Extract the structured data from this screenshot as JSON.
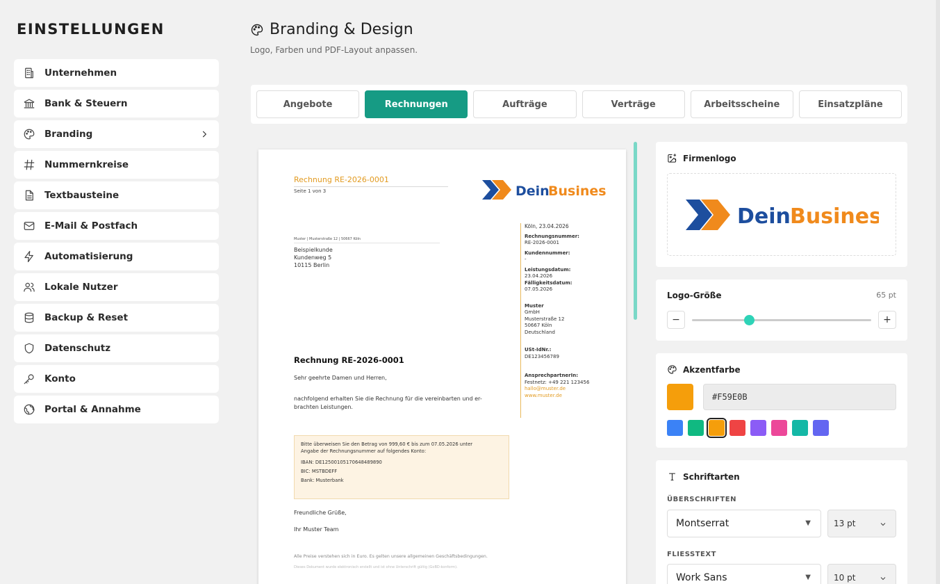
{
  "sidebar": {
    "title": "EINSTELLUNGEN",
    "items": [
      {
        "label": "Unternehmen",
        "icon": "building-icon"
      },
      {
        "label": "Bank & Steuern",
        "icon": "bank-icon"
      },
      {
        "label": "Branding",
        "icon": "palette-icon"
      },
      {
        "label": "Nummernkreise",
        "icon": "hash-icon"
      },
      {
        "label": "Textbausteine",
        "icon": "document-icon"
      },
      {
        "label": "E-Mail & Postfach",
        "icon": "mail-icon"
      },
      {
        "label": "Automatisierung",
        "icon": "lightning-icon"
      },
      {
        "label": "Lokale Nutzer",
        "icon": "users-icon"
      },
      {
        "label": "Backup & Reset",
        "icon": "database-icon"
      },
      {
        "label": "Datenschutz",
        "icon": "shield-icon"
      },
      {
        "label": "Konto",
        "icon": "key-icon"
      },
      {
        "label": "Portal & Annahme",
        "icon": "globe-icon"
      }
    ]
  },
  "header": {
    "title": "Branding & Design",
    "subtitle": "Logo, Farben und PDF-Layout anpassen."
  },
  "tabs": [
    {
      "label": "Angebote"
    },
    {
      "label": "Rechnungen",
      "active": true
    },
    {
      "label": "Aufträge"
    },
    {
      "label": "Verträge"
    },
    {
      "label": "Arbeitsscheine"
    },
    {
      "label": "Einsatzpläne"
    }
  ],
  "preview": {
    "doc_title": "Rechnung RE-2026-0001",
    "page_info": "Seite 1 von 3",
    "logo_text_1": "Dein",
    "logo_text_2": "Business",
    "sender_line": "Muster | Musterstraße 12 | 50667 Köln",
    "recipient": {
      "line1": "Beispielkunde",
      "line2": "Kundenweg 5",
      "line3": "10115 Berlin"
    },
    "meta": {
      "place_date": "Köln, 23.04.2026",
      "invoice_no_label": "Rechnungsnummer:",
      "invoice_no": "RE-2026-0001",
      "customer_no_label": "Kundennummer:",
      "customer_no": "-",
      "service_date_label": "Leistungsdatum:",
      "service_date": "23.04.2026",
      "due_label": "Fälligkeitsdatum:",
      "due": "07.05.2026",
      "company_name": "Muster",
      "company_form": "GmbH",
      "company_street": "Musterstraße 12",
      "company_city": "50667 Köln",
      "company_country": "Deutschland",
      "vat_label": "USt-IdNr.:",
      "vat": "DE123456789",
      "contact_label": "AnsprechpartnerIn:",
      "phone": "Festnetz: +49 221 123456",
      "email": "hallo@muster.de",
      "web": "www.muster.de"
    },
    "heading": "Rechnung RE-2026-0001",
    "greeting": "Sehr geehrte Damen und Herren,",
    "body_line1": "nachfolgend erhalten Sie die Rechnung für die vereinbarten und er-",
    "body_line2": "brachten Leistungen.",
    "payment": {
      "line1": "Bitte überweisen Sie den Betrag von 999,60 € bis zum 07.05.2026 unter",
      "line2": "Angabe der Rechnungsnummer auf folgendes Konto:",
      "iban": "IBAN: DE12500105170648489890",
      "bic": "BIC: MSTBDEFF",
      "bank": "Bank: Musterbank"
    },
    "regards": "Freundliche Grüße,",
    "team": "Ihr Muster Team",
    "footer1": "Alle Preise verstehen sich in Euro. Es gelten unsere allgemeinen Geschäftsbedingungen.",
    "footer2": "Dieses Dokument wurde elektronisch erstellt und ist ohne Unterschrift gültig (GoBD-konform)."
  },
  "logo_panel": {
    "title": "Firmenlogo",
    "logo_text_1": "Dein",
    "logo_text_2": "Business"
  },
  "size_panel": {
    "label": "Logo-Größe",
    "value": "65 pt",
    "slider_fraction": 0.32,
    "minus": "−",
    "plus": "+"
  },
  "accent_panel": {
    "title": "Akzentfarbe",
    "hex": "#F59E0B",
    "color": "#F59E0B",
    "swatches": [
      "#3B82F6",
      "#10B981",
      "#F59E0B",
      "#EF4444",
      "#8B5CF6",
      "#EC4899",
      "#14B8A6",
      "#6366F1"
    ],
    "selected_index": 2
  },
  "fonts_panel": {
    "title": "Schriftarten",
    "headings_label": "ÜBERSCHRIFTEN",
    "headings_font": "Montserrat",
    "headings_size": "13 pt",
    "body_label": "FLIESSTEXT",
    "body_font": "Work Sans",
    "body_size": "10 pt"
  },
  "colors": {
    "accent_tab": "#169B84",
    "doc_orange": "#E29A1F",
    "logo_blue": "#1D4E9E",
    "logo_orange": "#F08A1C"
  }
}
